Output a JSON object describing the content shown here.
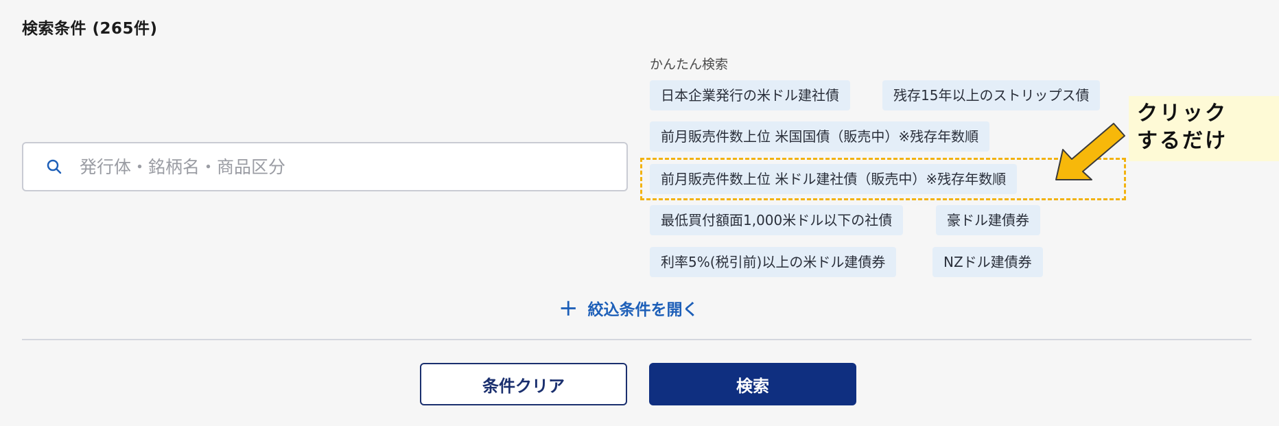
{
  "header": {
    "title": "検索条件",
    "count": "(265件)"
  },
  "search": {
    "placeholder": "発行体・銘柄名・商品区分",
    "value": ""
  },
  "quick_search": {
    "label": "かんたん検索",
    "items": [
      "日本企業発行の米ドル建社債",
      "残存15年以上のストリップス債",
      "前月販売件数上位 米国国債（販売中）※残存年数順",
      "前月販売件数上位 米ドル建社債（販売中）※残存年数順",
      "最低買付額面1,000米ドル以下の社債",
      "豪ドル建債券",
      "利率5%(税引前)以上の米ドル建債券",
      "NZドル建債券"
    ]
  },
  "annotation": {
    "line1": "クリック",
    "line2": "するだけ"
  },
  "filters": {
    "open_label": "絞込条件を開く"
  },
  "buttons": {
    "clear_label": "条件クリア",
    "search_label": "検索"
  },
  "colors": {
    "primary": "#0f2f80",
    "link": "#1d5fb8",
    "chip_bg": "#e4eef8",
    "highlight": "#f2b20f",
    "callout_bg": "#fefad6"
  }
}
